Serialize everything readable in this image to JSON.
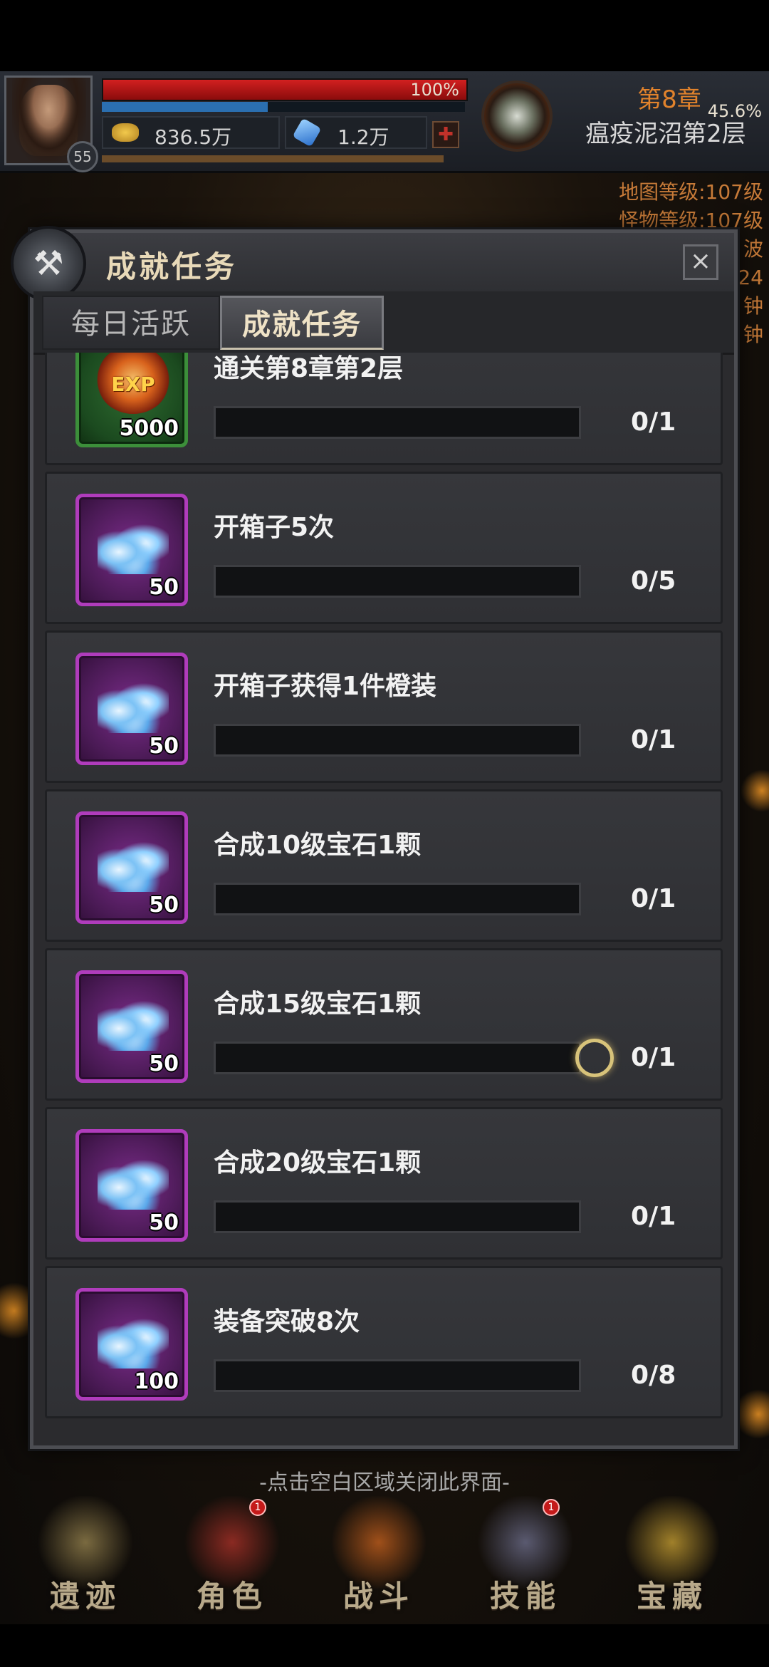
{
  "hud": {
    "level": "55",
    "hp_percent_text": "100%",
    "hp_fraction": 1.0,
    "xp_percent_text": "45.6%",
    "xp_fraction": 0.456,
    "gold": "836.5万",
    "gems": "1.2万",
    "chapter": "第8章",
    "stage": "瘟疫泥沼第2层",
    "side_info": [
      "地图等级:107级",
      "怪物等级:107级",
      "波",
      "24",
      "钟",
      "钟"
    ]
  },
  "modal": {
    "title": "成就任务",
    "close_icon": "close-icon",
    "tabs": [
      {
        "label": "每日活跃",
        "active": false
      },
      {
        "label": "成就任务",
        "active": true
      }
    ],
    "tasks": [
      {
        "name": "通关第8章第2层",
        "reward_type": "exp",
        "reward_qty": "5000",
        "reward_icon_text": "EXP",
        "progress_text": "0/1",
        "progress": 0
      },
      {
        "name": "开箱子5次",
        "reward_type": "gem",
        "reward_qty": "50",
        "progress_text": "0/5",
        "progress": 0
      },
      {
        "name": "开箱子获得1件橙装",
        "reward_type": "gem",
        "reward_qty": "50",
        "progress_text": "0/1",
        "progress": 0
      },
      {
        "name": "合成10级宝石1颗",
        "reward_type": "gem",
        "reward_qty": "50",
        "progress_text": "0/1",
        "progress": 0
      },
      {
        "name": "合成15级宝石1颗",
        "reward_type": "gem",
        "reward_qty": "50",
        "progress_text": "0/1",
        "progress": 0
      },
      {
        "name": "合成20级宝石1颗",
        "reward_type": "gem",
        "reward_qty": "50",
        "progress_text": "0/1",
        "progress": 0
      },
      {
        "name": "装备突破8次",
        "reward_type": "gem",
        "reward_qty": "100",
        "progress_text": "0/8",
        "progress": 0
      }
    ]
  },
  "close_hint": "-点击空白区域关闭此界面-",
  "nav": [
    {
      "label": "遗迹",
      "badge": "",
      "color": "#7a6a40"
    },
    {
      "label": "角色",
      "badge": "1",
      "color": "#8a2a22"
    },
    {
      "label": "战斗",
      "badge": "",
      "color": "#a0501a"
    },
    {
      "label": "技能",
      "badge": "1",
      "color": "#5a5a70"
    },
    {
      "label": "宝藏",
      "badge": "",
      "color": "#a0802a"
    }
  ],
  "colors": {
    "accent_gold": "#e0822c",
    "reward_purple": "#b03cbc",
    "reward_green": "#3c8f3a"
  }
}
